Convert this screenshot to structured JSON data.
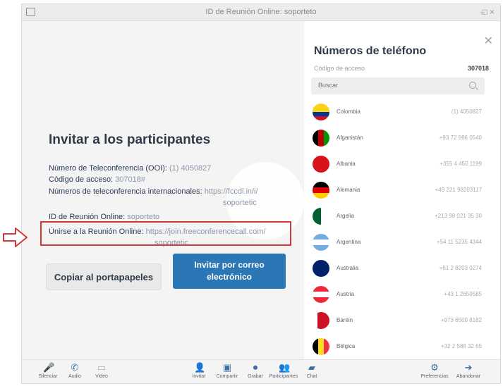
{
  "window": {
    "title": "ID de Reunión Online: soporteto"
  },
  "invite": {
    "title": "Invitar a los participantes",
    "conf_number_label": "Número de Teleconferencia (OOI):",
    "conf_number_value": "(1) 4050827",
    "access_code_label": "Código de acceso:",
    "access_code_value": "307018#",
    "intl_label": "Números de teleconferencia internacionales:",
    "intl_value_1": "https://fccdl.in/i/",
    "intl_value_2": "soportetic",
    "meeting_id_label": "ID de Reunión Online:",
    "meeting_id_value": "soporteto",
    "join_label": "Únirse a la Reunión Online:",
    "join_value_1": "https://join.freeconferencecall.com/",
    "join_value_2": "soportetic",
    "copy_button": "Copiar al portapapeles",
    "email_button_line1": "Invitar por correo",
    "email_button_line2": "electrónico"
  },
  "phone_panel": {
    "title": "Números de teléfono",
    "access_label": "Código de acceso",
    "access_value": "307018",
    "search_placeholder": "Buscar",
    "countries": [
      {
        "name": "Colombia",
        "number": "(1) 4050827",
        "flag": "colombia"
      },
      {
        "name": "Afganistán",
        "number": "+93 72 986 0540",
        "flag": "afghanistan"
      },
      {
        "name": "Albania",
        "number": "+355 4 450 1199",
        "flag": "albania"
      },
      {
        "name": "Alemania",
        "number": "+49 221 98203117",
        "flag": "germany"
      },
      {
        "name": "Argelia",
        "number": "+213 98 021 35 30",
        "flag": "algeria"
      },
      {
        "name": "Argentina",
        "number": "+54 11 5235 4344",
        "flag": "argentina"
      },
      {
        "name": "Australia",
        "number": "+61 2 8203 0274",
        "flag": "australia"
      },
      {
        "name": "Austria",
        "number": "+43 1 2650585",
        "flag": "austria"
      },
      {
        "name": "Baréin",
        "number": "+973 6500 8182",
        "flag": "bahrain"
      },
      {
        "name": "Bélgica",
        "number": "+32 2 588 32 65",
        "flag": "belgium"
      }
    ]
  },
  "toolbar": {
    "left": [
      {
        "label": "Silenciar",
        "icon": "microphone-icon"
      },
      {
        "label": "Audio",
        "icon": "phone-icon"
      },
      {
        "label": "Video",
        "icon": "video-icon"
      }
    ],
    "center": [
      {
        "label": "Invitar",
        "icon": "add-user-icon"
      },
      {
        "label": "Compartir",
        "icon": "share-screen-icon"
      },
      {
        "label": "Grabar",
        "icon": "record-icon"
      },
      {
        "label": "Participantes",
        "icon": "participants-icon"
      },
      {
        "label": "Chat",
        "icon": "chat-icon"
      }
    ],
    "right": [
      {
        "label": "Preferencias",
        "icon": "gear-icon"
      },
      {
        "label": "Abandonar",
        "icon": "exit-icon"
      }
    ]
  },
  "colors": {
    "accent": "#2b76b4",
    "annotation": "#d23a3a"
  }
}
